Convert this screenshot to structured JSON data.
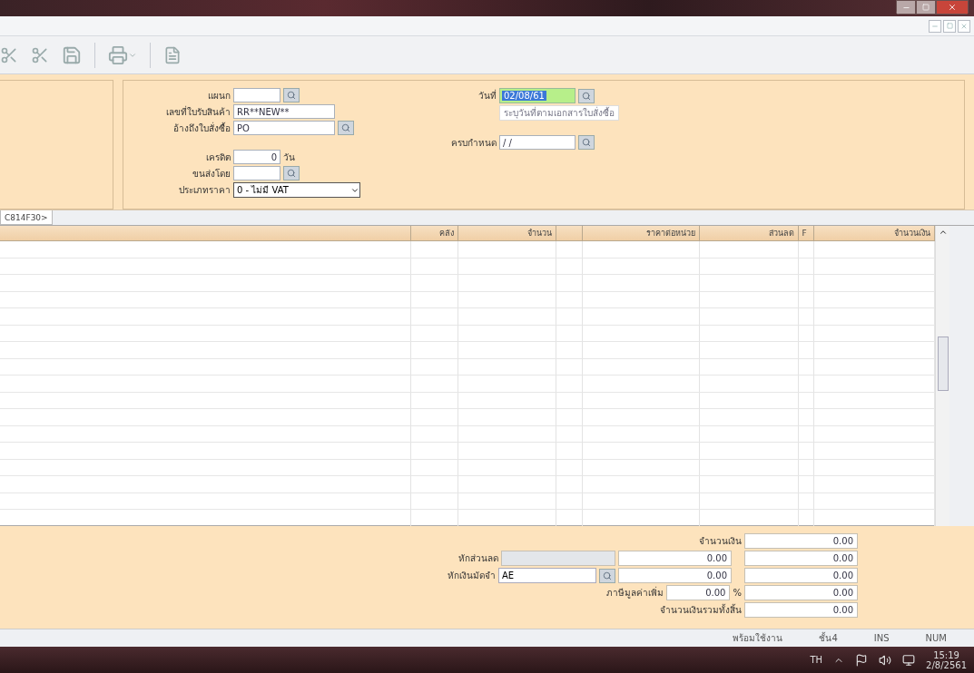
{
  "form": {
    "fields": [
      {
        "label": "แผนก",
        "lookup": true,
        "kind": "short"
      },
      {
        "label": "เลขที่ใบรับสินค้า",
        "value": "RR**NEW**",
        "lookup": false,
        "kind": "long"
      },
      {
        "label": "อ้างถึงใบสั่งซื้อ",
        "value": "PO",
        "lookup": true,
        "kind": "long"
      },
      {
        "label": "เครดิต",
        "value": "0",
        "unit": "วัน",
        "lookup": false,
        "kind": "number"
      },
      {
        "label": "ขนส่งโดย",
        "lookup": true,
        "kind": "short"
      },
      {
        "label": "ประเภทราคา",
        "value": "0 - ไม่มี VAT",
        "lookup": false,
        "kind": "select"
      }
    ],
    "date": {
      "label": "วันที่",
      "value": "02/08/61",
      "hint": "ระบุวันที่ตามเอกสารใบสั่งซื้อ"
    },
    "due": {
      "label": "ครบกำหนด",
      "value": " / /"
    }
  },
  "tab": {
    "label": "C814F30>"
  },
  "table": {
    "columns": [
      "",
      "คลัง",
      "จำนวน",
      "",
      "ราคาต่อหน่วย",
      "ส่วนลด",
      "F",
      "จำนวนเงิน"
    ]
  },
  "totals": [
    {
      "label": "จำนวนเงิน",
      "kind": "plain",
      "total": "0.00"
    },
    {
      "label": "หักส่วนลด",
      "kind": "discount",
      "amount": "0.00",
      "total": "0.00"
    },
    {
      "label": "หักเงินมัดจำ",
      "kind": "deposit",
      "code": "AE",
      "amount": "0.00",
      "total": "0.00"
    },
    {
      "label": "ภาษีมูลค่าเพิ่ม",
      "kind": "vat",
      "rate": "0.00",
      "unit": "%",
      "total": "0.00"
    },
    {
      "label": "จำนวนเงินรวมทั้งสิ้น",
      "kind": "plain",
      "total": "0.00"
    }
  ],
  "status_bar": [
    "พร้อมใช้งาน",
    "ชั้น4",
    "INS",
    "NUM"
  ],
  "taskbar": {
    "language": "TH",
    "time": "15:19",
    "date": "2/8/2561"
  }
}
